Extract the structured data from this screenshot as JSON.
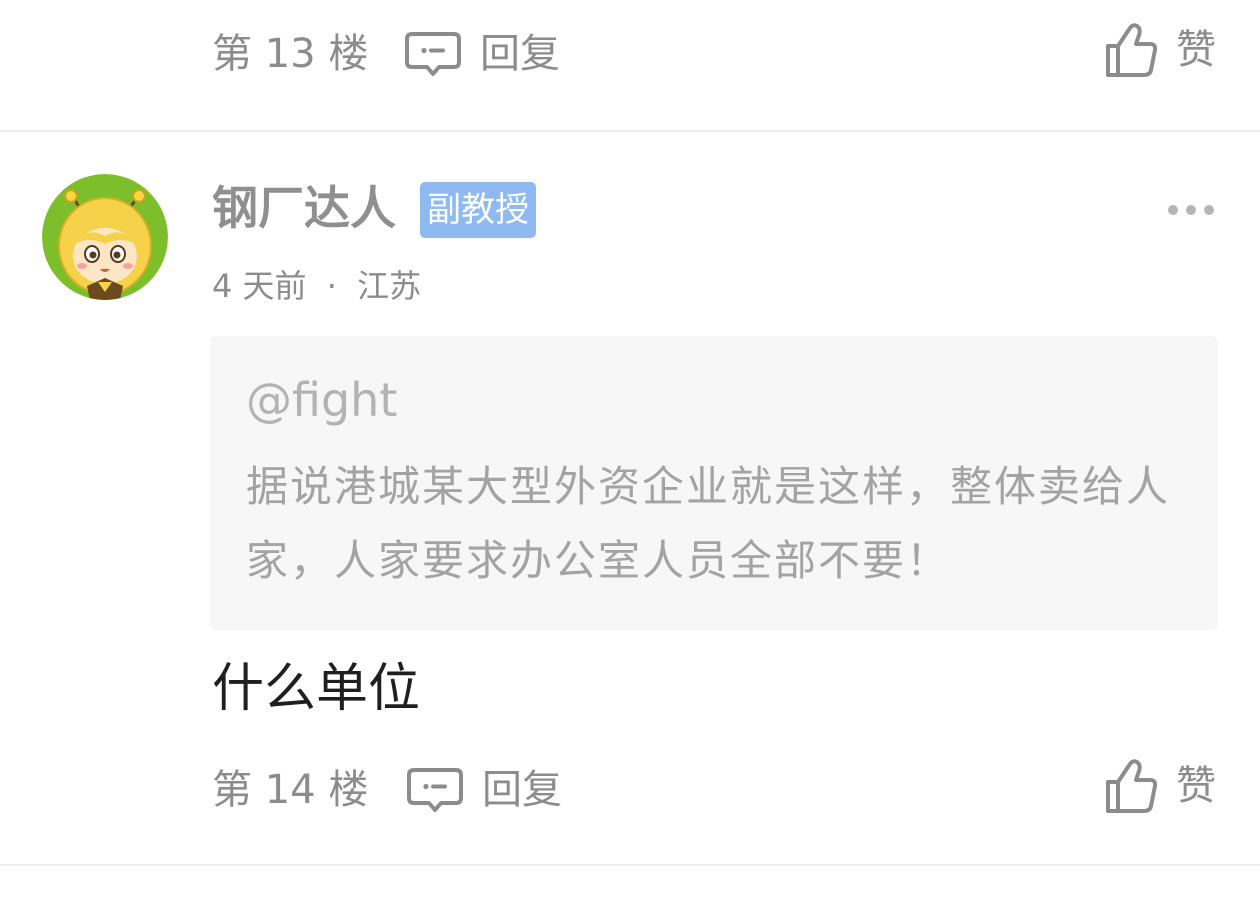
{
  "previous_comment": {
    "floor_label": "第 13 楼",
    "reply_label": "回复",
    "like_label": "赞"
  },
  "comment": {
    "username": "钢厂达人",
    "rank_badge": "副教授",
    "time_ago": "4 天前",
    "meta_separator": "·",
    "location": "江苏",
    "quote": {
      "user": "@fight",
      "text": "据说港城某大型外资企业就是这样，整体卖给人家，人家要求办公室人员全部不要！"
    },
    "text": "什么单位",
    "floor_label": "第 14 楼",
    "reply_label": "回复",
    "like_label": "赞"
  },
  "colors": {
    "badge_bg": "#8fb9f1",
    "muted_text": "#8c8c8c",
    "quote_bg": "#f7f7f7",
    "avatar_bg": "#7cbf2a"
  },
  "icons": {
    "reply": "comment-bubble-icon",
    "like": "thumbs-up-icon",
    "more": "more-dots-icon"
  }
}
